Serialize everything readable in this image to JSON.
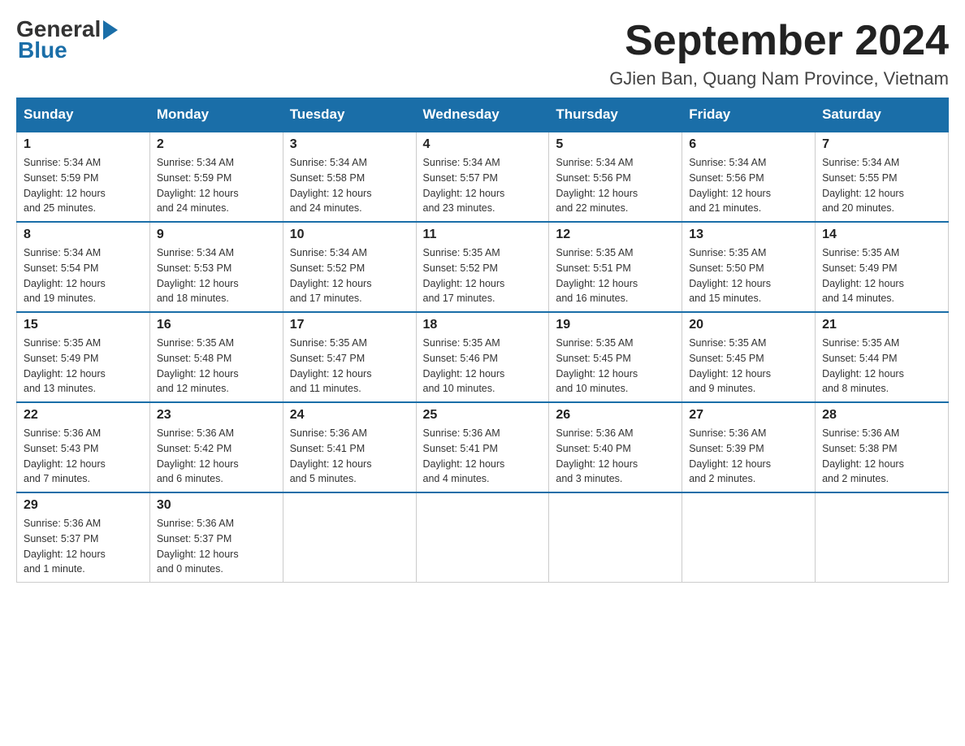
{
  "header": {
    "logo_general": "General",
    "logo_blue": "Blue",
    "month_title": "September 2024",
    "location": "GJien Ban, Quang Nam Province, Vietnam"
  },
  "calendar": {
    "days_of_week": [
      "Sunday",
      "Monday",
      "Tuesday",
      "Wednesday",
      "Thursday",
      "Friday",
      "Saturday"
    ],
    "weeks": [
      [
        {
          "day": "1",
          "info": "Sunrise: 5:34 AM\nSunset: 5:59 PM\nDaylight: 12 hours\nand 25 minutes."
        },
        {
          "day": "2",
          "info": "Sunrise: 5:34 AM\nSunset: 5:59 PM\nDaylight: 12 hours\nand 24 minutes."
        },
        {
          "day": "3",
          "info": "Sunrise: 5:34 AM\nSunset: 5:58 PM\nDaylight: 12 hours\nand 24 minutes."
        },
        {
          "day": "4",
          "info": "Sunrise: 5:34 AM\nSunset: 5:57 PM\nDaylight: 12 hours\nand 23 minutes."
        },
        {
          "day": "5",
          "info": "Sunrise: 5:34 AM\nSunset: 5:56 PM\nDaylight: 12 hours\nand 22 minutes."
        },
        {
          "day": "6",
          "info": "Sunrise: 5:34 AM\nSunset: 5:56 PM\nDaylight: 12 hours\nand 21 minutes."
        },
        {
          "day": "7",
          "info": "Sunrise: 5:34 AM\nSunset: 5:55 PM\nDaylight: 12 hours\nand 20 minutes."
        }
      ],
      [
        {
          "day": "8",
          "info": "Sunrise: 5:34 AM\nSunset: 5:54 PM\nDaylight: 12 hours\nand 19 minutes."
        },
        {
          "day": "9",
          "info": "Sunrise: 5:34 AM\nSunset: 5:53 PM\nDaylight: 12 hours\nand 18 minutes."
        },
        {
          "day": "10",
          "info": "Sunrise: 5:34 AM\nSunset: 5:52 PM\nDaylight: 12 hours\nand 17 minutes."
        },
        {
          "day": "11",
          "info": "Sunrise: 5:35 AM\nSunset: 5:52 PM\nDaylight: 12 hours\nand 17 minutes."
        },
        {
          "day": "12",
          "info": "Sunrise: 5:35 AM\nSunset: 5:51 PM\nDaylight: 12 hours\nand 16 minutes."
        },
        {
          "day": "13",
          "info": "Sunrise: 5:35 AM\nSunset: 5:50 PM\nDaylight: 12 hours\nand 15 minutes."
        },
        {
          "day": "14",
          "info": "Sunrise: 5:35 AM\nSunset: 5:49 PM\nDaylight: 12 hours\nand 14 minutes."
        }
      ],
      [
        {
          "day": "15",
          "info": "Sunrise: 5:35 AM\nSunset: 5:49 PM\nDaylight: 12 hours\nand 13 minutes."
        },
        {
          "day": "16",
          "info": "Sunrise: 5:35 AM\nSunset: 5:48 PM\nDaylight: 12 hours\nand 12 minutes."
        },
        {
          "day": "17",
          "info": "Sunrise: 5:35 AM\nSunset: 5:47 PM\nDaylight: 12 hours\nand 11 minutes."
        },
        {
          "day": "18",
          "info": "Sunrise: 5:35 AM\nSunset: 5:46 PM\nDaylight: 12 hours\nand 10 minutes."
        },
        {
          "day": "19",
          "info": "Sunrise: 5:35 AM\nSunset: 5:45 PM\nDaylight: 12 hours\nand 10 minutes."
        },
        {
          "day": "20",
          "info": "Sunrise: 5:35 AM\nSunset: 5:45 PM\nDaylight: 12 hours\nand 9 minutes."
        },
        {
          "day": "21",
          "info": "Sunrise: 5:35 AM\nSunset: 5:44 PM\nDaylight: 12 hours\nand 8 minutes."
        }
      ],
      [
        {
          "day": "22",
          "info": "Sunrise: 5:36 AM\nSunset: 5:43 PM\nDaylight: 12 hours\nand 7 minutes."
        },
        {
          "day": "23",
          "info": "Sunrise: 5:36 AM\nSunset: 5:42 PM\nDaylight: 12 hours\nand 6 minutes."
        },
        {
          "day": "24",
          "info": "Sunrise: 5:36 AM\nSunset: 5:41 PM\nDaylight: 12 hours\nand 5 minutes."
        },
        {
          "day": "25",
          "info": "Sunrise: 5:36 AM\nSunset: 5:41 PM\nDaylight: 12 hours\nand 4 minutes."
        },
        {
          "day": "26",
          "info": "Sunrise: 5:36 AM\nSunset: 5:40 PM\nDaylight: 12 hours\nand 3 minutes."
        },
        {
          "day": "27",
          "info": "Sunrise: 5:36 AM\nSunset: 5:39 PM\nDaylight: 12 hours\nand 2 minutes."
        },
        {
          "day": "28",
          "info": "Sunrise: 5:36 AM\nSunset: 5:38 PM\nDaylight: 12 hours\nand 2 minutes."
        }
      ],
      [
        {
          "day": "29",
          "info": "Sunrise: 5:36 AM\nSunset: 5:37 PM\nDaylight: 12 hours\nand 1 minute."
        },
        {
          "day": "30",
          "info": "Sunrise: 5:36 AM\nSunset: 5:37 PM\nDaylight: 12 hours\nand 0 minutes."
        },
        {
          "day": "",
          "info": ""
        },
        {
          "day": "",
          "info": ""
        },
        {
          "day": "",
          "info": ""
        },
        {
          "day": "",
          "info": ""
        },
        {
          "day": "",
          "info": ""
        }
      ]
    ]
  }
}
